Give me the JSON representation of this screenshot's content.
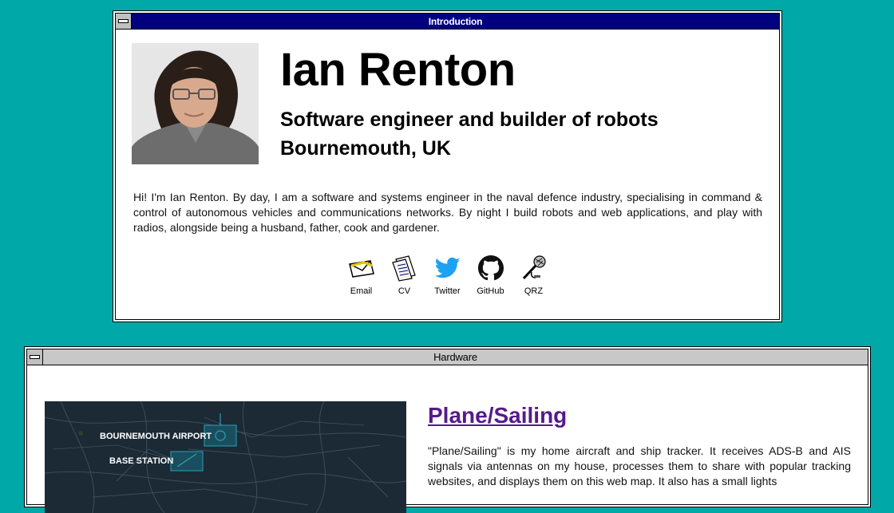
{
  "intro_window": {
    "title": "Introduction",
    "name": "Ian Renton",
    "subtitle": "Software engineer and builder of robots",
    "location": "Bournemouth, UK",
    "bio": "Hi! I'm Ian Renton. By day, I am a software and systems engineer in the naval defence industry, specialising in command & control of autonomous vehicles and communications networks. By night I build robots and web applications, and play with radios, alongside being a husband, father, cook and gardener.",
    "links": [
      {
        "label": "Email",
        "icon": "email-icon"
      },
      {
        "label": "CV",
        "icon": "cv-icon"
      },
      {
        "label": "Twitter",
        "icon": "twitter-icon"
      },
      {
        "label": "GitHub",
        "icon": "github-icon"
      },
      {
        "label": "QRZ",
        "icon": "microphone-icon"
      }
    ]
  },
  "hardware_window": {
    "title": "Hardware",
    "project": {
      "title": "Plane/Sailing",
      "description": "\"Plane/Sailing\" is my home aircraft and ship tracker. It receives ADS-B and AIS signals via antennas on my house, processes them to share with popular tracking websites, and displays them on this web map. It also has a small lights",
      "map_labels": [
        "BOURNEMOUTH AIRPORT",
        "BASE STATION"
      ]
    }
  },
  "colors": {
    "desktop": "#00a8a8",
    "active_title": "#000080",
    "inactive_title": "#c8c8c8",
    "link": "#551a8b"
  }
}
